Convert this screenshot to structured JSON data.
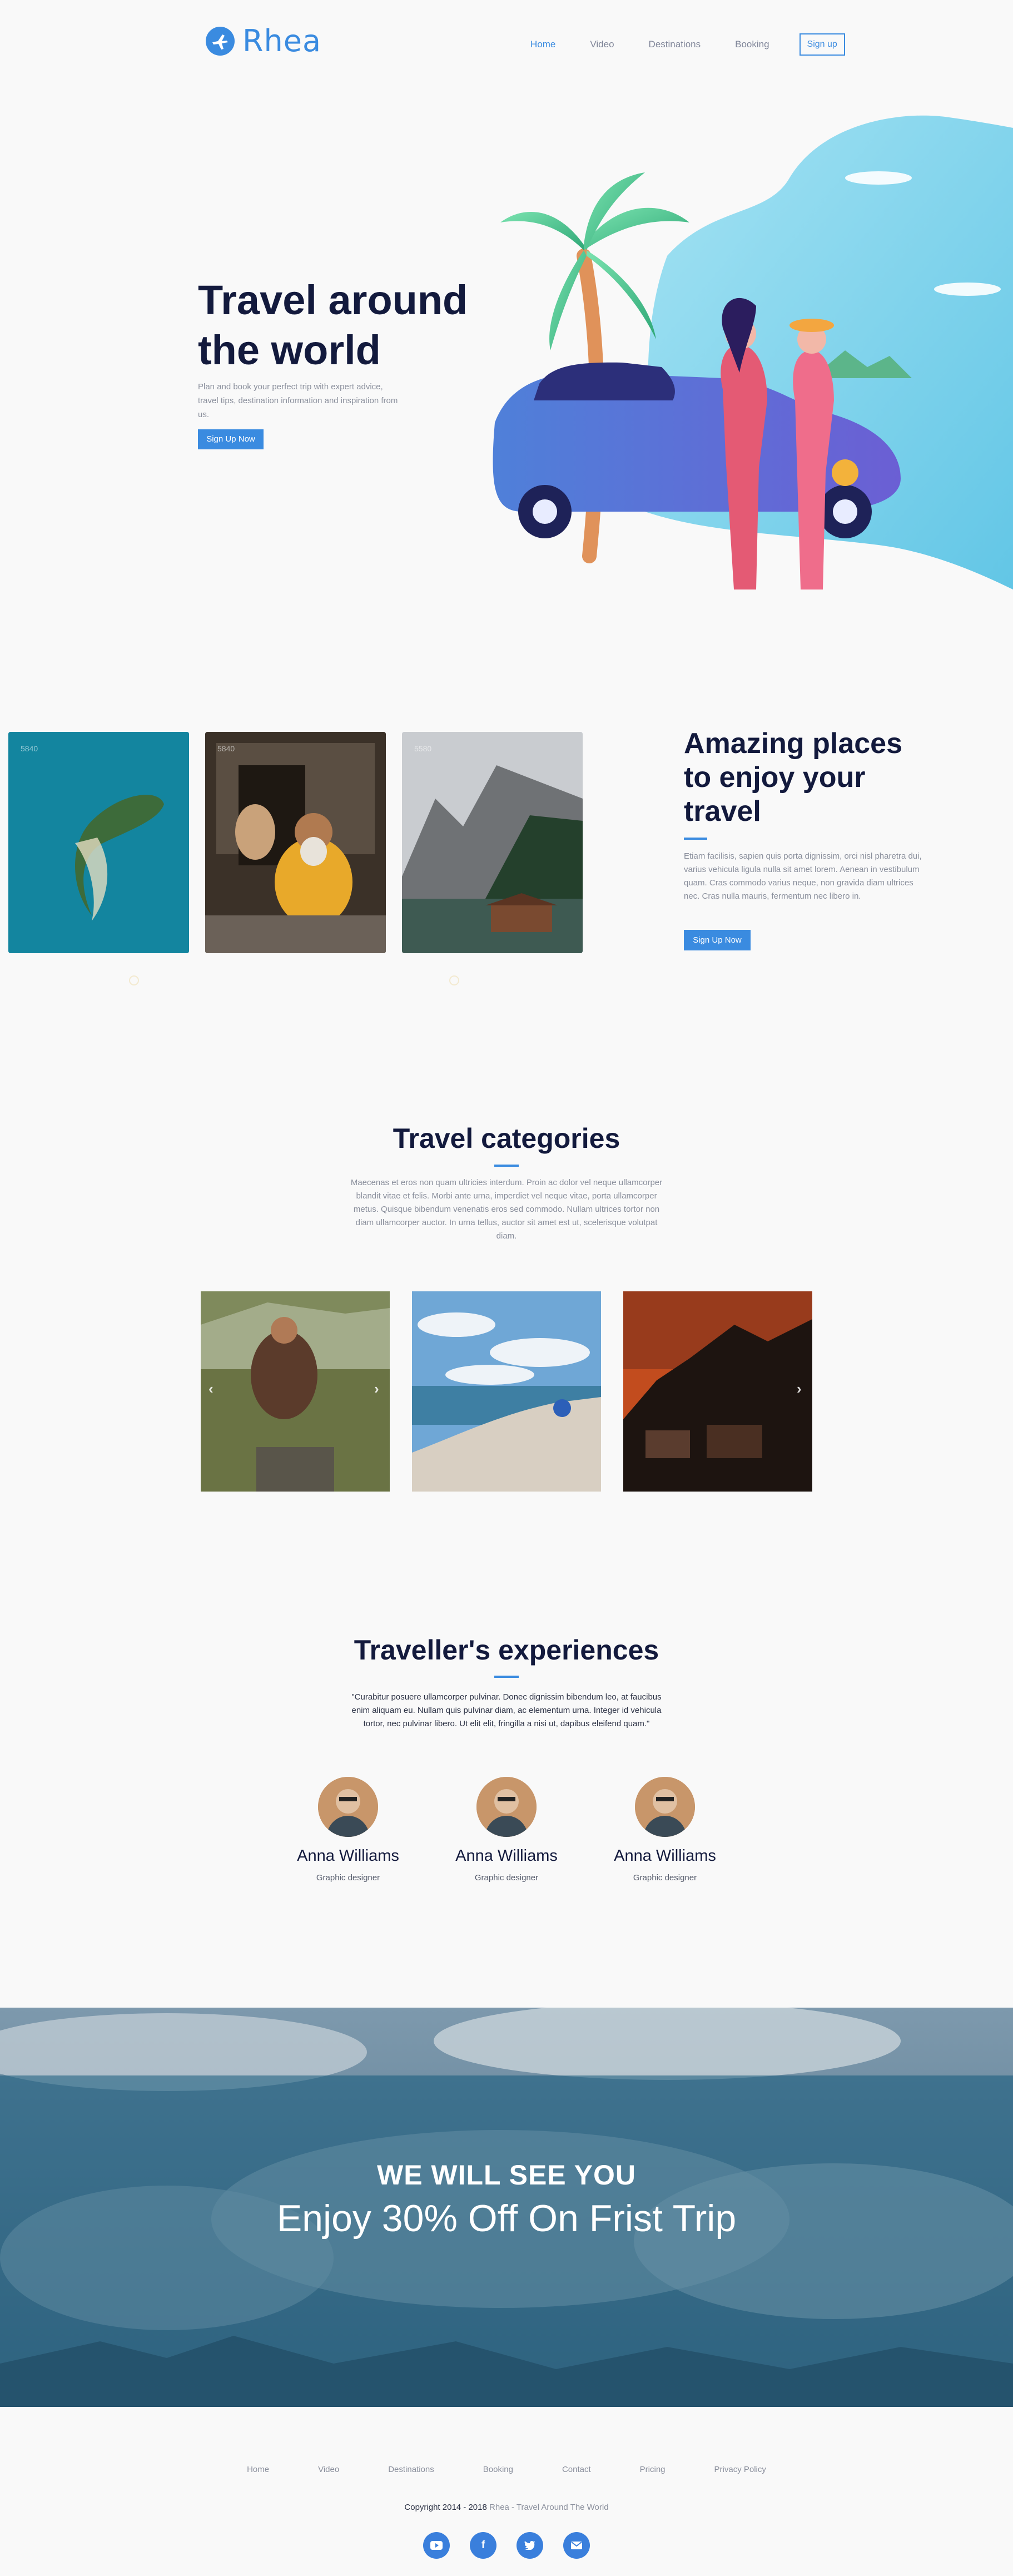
{
  "brand": {
    "name": "Rhea"
  },
  "nav": {
    "items": [
      "Home",
      "Video",
      "Destinations",
      "Booking"
    ],
    "signup": "Sign up"
  },
  "hero": {
    "title": "Travel around the world",
    "text": "Plan and book your perfect trip with expert advice, travel tips, destination information and inspiration from us.",
    "button": "Sign Up Now"
  },
  "places": {
    "cards": [
      "5840",
      "5840",
      "5580"
    ],
    "title": "Amazing places to enjoy your travel",
    "text": "Etiam facilisis, sapien quis porta dignissim, orci nisl pharetra dui, varius vehicula ligula nulla sit amet lorem. Aenean in vestibulum quam. Cras commodo varius neque, non gravida diam ultrices nec. Cras nulla mauris, fermentum nec libero in.",
    "button": "Sign Up Now"
  },
  "categories": {
    "title": "Travel categories",
    "text": "Maecenas et eros non quam ultricies interdum. Proin ac dolor vel neque ullamcorper blandit vitae et felis. Morbi ante urna, imperdiet vel neque vitae, porta ullamcorper metus. Quisque bibendum venenatis eros sed commodo. Nullam ultrices tortor non diam ullamcorper auctor. In urna tellus, auctor sit amet est ut, scelerisque volutpat diam."
  },
  "experiences": {
    "title": "Traveller's experiences",
    "quote": "\"Curabitur posuere ullamcorper pulvinar. Donec dignissim bibendum leo, at faucibus enim aliquam eu. Nullam quis pulvinar diam, ac elementum urna. Integer id vehicula tortor, nec pulvinar libero. Ut elit elit, fringilla a nisi ut, dapibus eleifend quam.\"",
    "people": [
      {
        "name": "Anna Williams",
        "role": "Graphic designer"
      },
      {
        "name": "Anna Williams",
        "role": "Graphic designer"
      },
      {
        "name": "Anna Williams",
        "role": "Graphic designer"
      }
    ]
  },
  "banner": {
    "heading": "WE WILL SEE YOU",
    "subheading": "Enjoy 30% Off On Frist Trip"
  },
  "footer": {
    "menu": [
      "Home",
      "Video",
      "Destinations",
      "Booking",
      "Contact",
      "Pricing",
      "Privacy Policy"
    ],
    "copyright": "Copyright 2014 - 2018",
    "brand_line": "Rhea - Travel Around The World",
    "social": [
      "youtube-icon",
      "facebook-icon",
      "twitter-icon",
      "email-icon"
    ]
  },
  "colors": {
    "accent": "#3a8be0",
    "heading": "#131a3d",
    "muted": "#8a8f9c"
  }
}
